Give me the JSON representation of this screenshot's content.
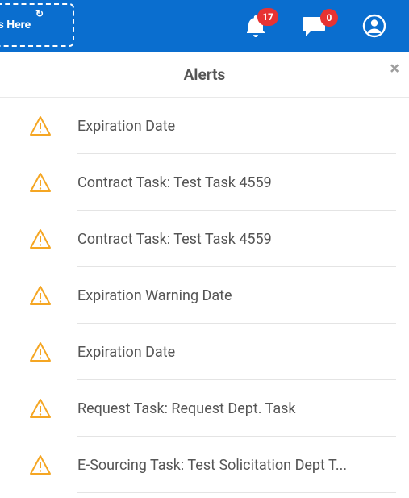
{
  "header": {
    "dashed_label": "es Here",
    "notifications_count": "17",
    "messages_count": "0"
  },
  "panel": {
    "title": "Alerts",
    "close_glyph": "×",
    "items": [
      {
        "title": "Expiration Date"
      },
      {
        "title": "Contract Task: Test Task 4559"
      },
      {
        "title": "Contract Task: Test Task 4559"
      },
      {
        "title": "Expiration Warning Date"
      },
      {
        "title": "Expiration Date"
      },
      {
        "title": "Request Task: Request Dept. Task"
      },
      {
        "title": "E-Sourcing Task: Test Solicitation Dept T..."
      }
    ]
  }
}
